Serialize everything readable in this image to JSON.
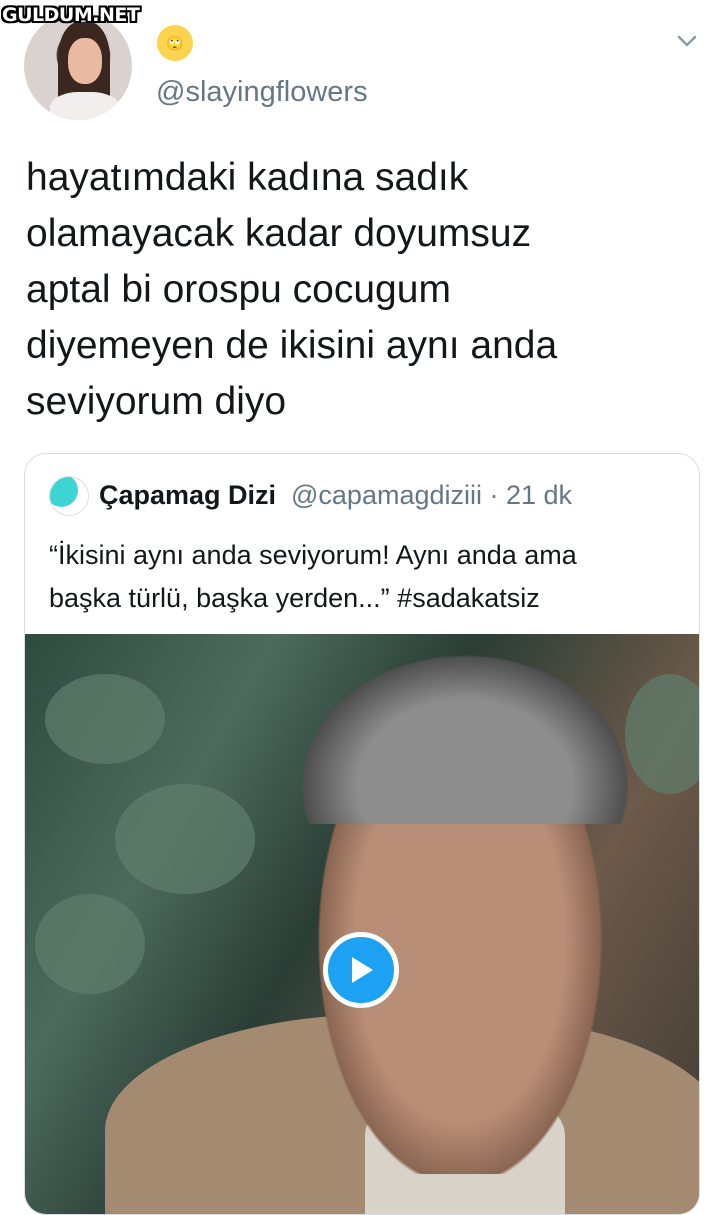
{
  "watermark": "GULDUM.NET",
  "author": {
    "emoji": "🙄",
    "handle": "@slayingflowers"
  },
  "tweet": {
    "lines": [
      "hayatımdaki kadına sadık",
      "olamayacak kadar doyumsuz",
      "aptal bi orospu cocugum",
      "diyemeyen de ikisini aynı anda",
      "seviyorum diyo"
    ]
  },
  "quoted": {
    "name": "Çapamag Dizi",
    "handle_time": "@capamagdiziii · 21 dk",
    "lines": [
      "“İkisini aynı anda seviyorum! Aynı anda ama",
      "başka türlü, başka yerden...” #sadakatsiz"
    ],
    "media": {
      "type": "video",
      "play_icon": "play-icon"
    }
  },
  "colors": {
    "accent": "#1da1f2",
    "secondary_text": "#657786",
    "primary_text": "#14171a"
  }
}
